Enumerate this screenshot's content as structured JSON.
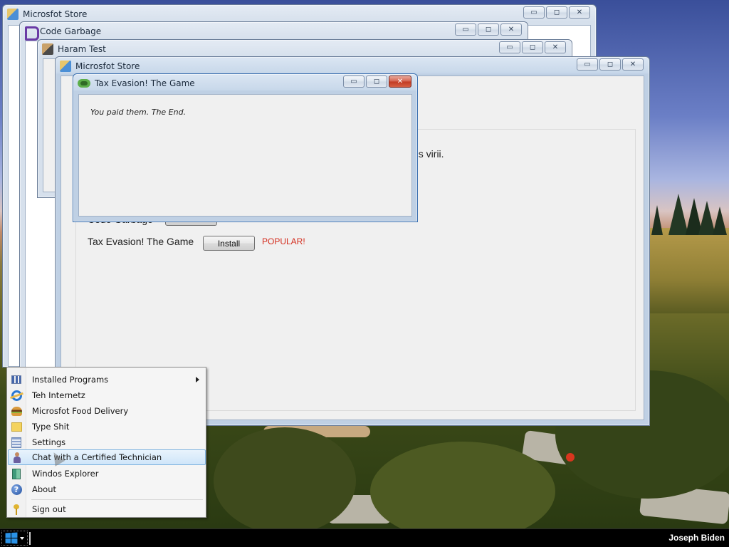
{
  "windows": {
    "store_back": {
      "title": "Microsfot Store"
    },
    "code_garbage": {
      "title": "Code Garbage"
    },
    "haram_test": {
      "title": "Haram Test"
    },
    "store_front": {
      "title": "Microsfot Store",
      "visible_fragment": "ns virii.",
      "partial_row_label": "Code Garbage",
      "row": {
        "label": "Tax Evasion! The Game",
        "install_label": "Install",
        "badge": "POPULAR!"
      }
    },
    "game": {
      "title": "Tax Evasion! The Game",
      "message": "You paid them. The End."
    }
  },
  "caption_buttons": {
    "minimize": "▭",
    "maximize": "◻",
    "close": "✕"
  },
  "start_menu": {
    "items": [
      {
        "label": "Installed Programs",
        "icon": "programs-grid-icon",
        "has_submenu": true
      },
      {
        "label": "Teh Internetz",
        "icon": "internet-explorer-icon"
      },
      {
        "label": "Microsfot Food Delivery",
        "icon": "burger-icon"
      },
      {
        "label": "Type Shit",
        "icon": "notepad-icon"
      },
      {
        "label": "Settings",
        "icon": "settings-icon"
      },
      {
        "label": "Chat with a Certified Technician",
        "icon": "technician-icon",
        "hovered": true
      },
      {
        "label": "Windos Explorer",
        "icon": "explorer-icon"
      },
      {
        "label": "About",
        "icon": "help-icon"
      }
    ],
    "sign_out": {
      "label": "Sign out",
      "icon": "key-icon"
    }
  },
  "taskbar": {
    "user": "Joseph Biden"
  },
  "colors": {
    "popular": "#d42d1e",
    "hover": "#cfe5f9",
    "start_logo": "#2a92e6"
  }
}
